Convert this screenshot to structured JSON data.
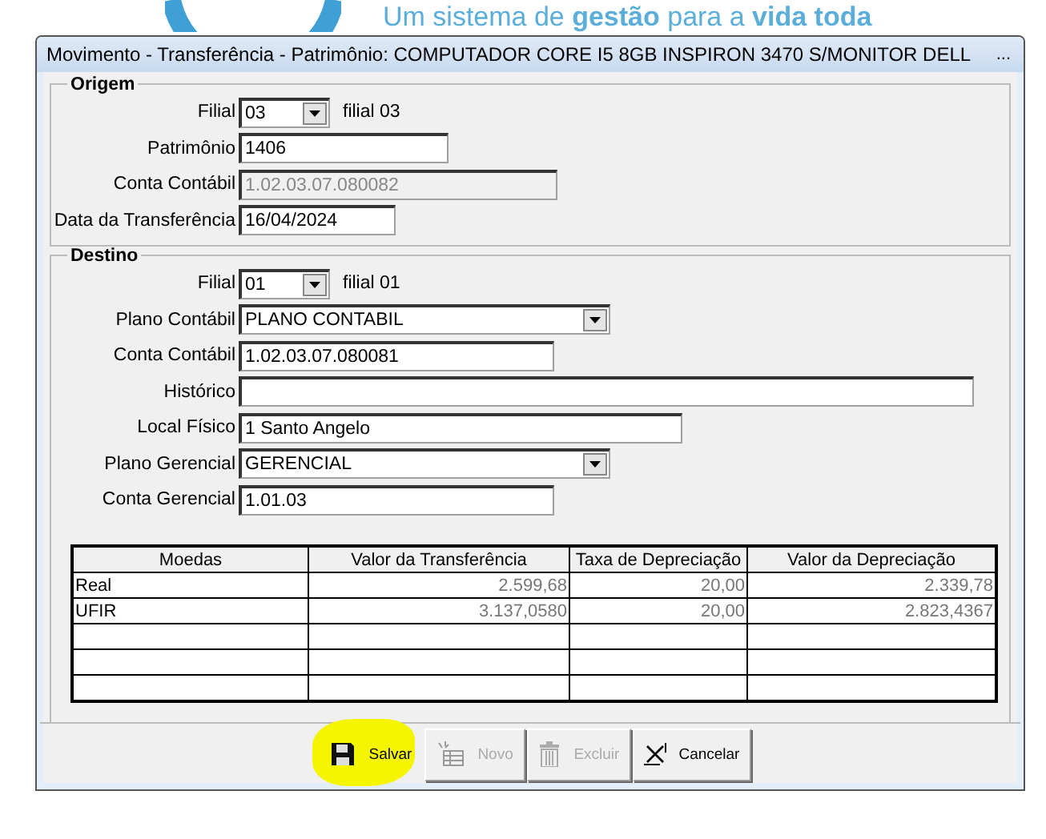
{
  "banner": {
    "tagline": "Um sistema de **gestão** para a **vida toda**"
  },
  "window": {
    "title": "Movimento - Transferência - Patrimônio: COMPUTADOR CORE I5 8GB INSPIRON 3470 S/MONITOR DELL",
    "overflow_glyph": "..."
  },
  "origem": {
    "legend": "Origem",
    "fields": [
      {
        "kind": "combo",
        "label": "Filial",
        "value": "03",
        "note": "filial 03",
        "disabled": false
      },
      {
        "kind": "text",
        "label": "Patrimônio",
        "value": "1406",
        "disabled": false
      },
      {
        "kind": "text",
        "label": "Conta Contábil",
        "value": "1.02.03.07.080082",
        "disabled": true
      },
      {
        "kind": "text",
        "label": "Data da Transferência",
        "value": "16/04/2024",
        "disabled": false
      }
    ]
  },
  "destino": {
    "legend": "Destino",
    "fields": [
      {
        "kind": "combo",
        "label": "Filial",
        "value": "01",
        "note": "filial 01",
        "disabled": false
      },
      {
        "kind": "combo",
        "label": "Plano Contábil",
        "value": "PLANO CONTABIL",
        "disabled": false
      },
      {
        "kind": "text",
        "label": "Conta Contábil",
        "value": "1.02.03.07.080081",
        "disabled": false
      },
      {
        "kind": "text",
        "label": "Histórico",
        "disabled": false
      },
      {
        "kind": "text",
        "label": "Local Físico",
        "value": "1 Santo Angelo",
        "disabled": false
      },
      {
        "kind": "combo",
        "label": "Plano Gerencial",
        "value": "GERENCIAL",
        "disabled": false
      },
      {
        "kind": "text",
        "label": "Conta Gerencial",
        "value": "1.01.03",
        "disabled": false
      }
    ]
  },
  "table": {
    "columns": [
      "Moedas",
      "Valor da Transferência",
      "Taxa de Depreciação",
      "Valor da Depreciação"
    ],
    "rows": [
      [
        "Real",
        "2.599,68",
        "20,00",
        "2.339,78"
      ],
      [
        "UFIR",
        "3.137,0580",
        "20,00",
        "2.823,4367"
      ]
    ]
  },
  "buttons": [
    {
      "kind": "save",
      "label": "Salvar",
      "disabled": false,
      "highlighted": true
    },
    {
      "kind": "new",
      "label": "Novo",
      "disabled": true,
      "highlighted": false
    },
    {
      "kind": "delete",
      "label": "Excluir",
      "disabled": true,
      "highlighted": false
    },
    {
      "kind": "cancel",
      "label": "Cancelar",
      "disabled": false,
      "highlighted": false
    }
  ]
}
